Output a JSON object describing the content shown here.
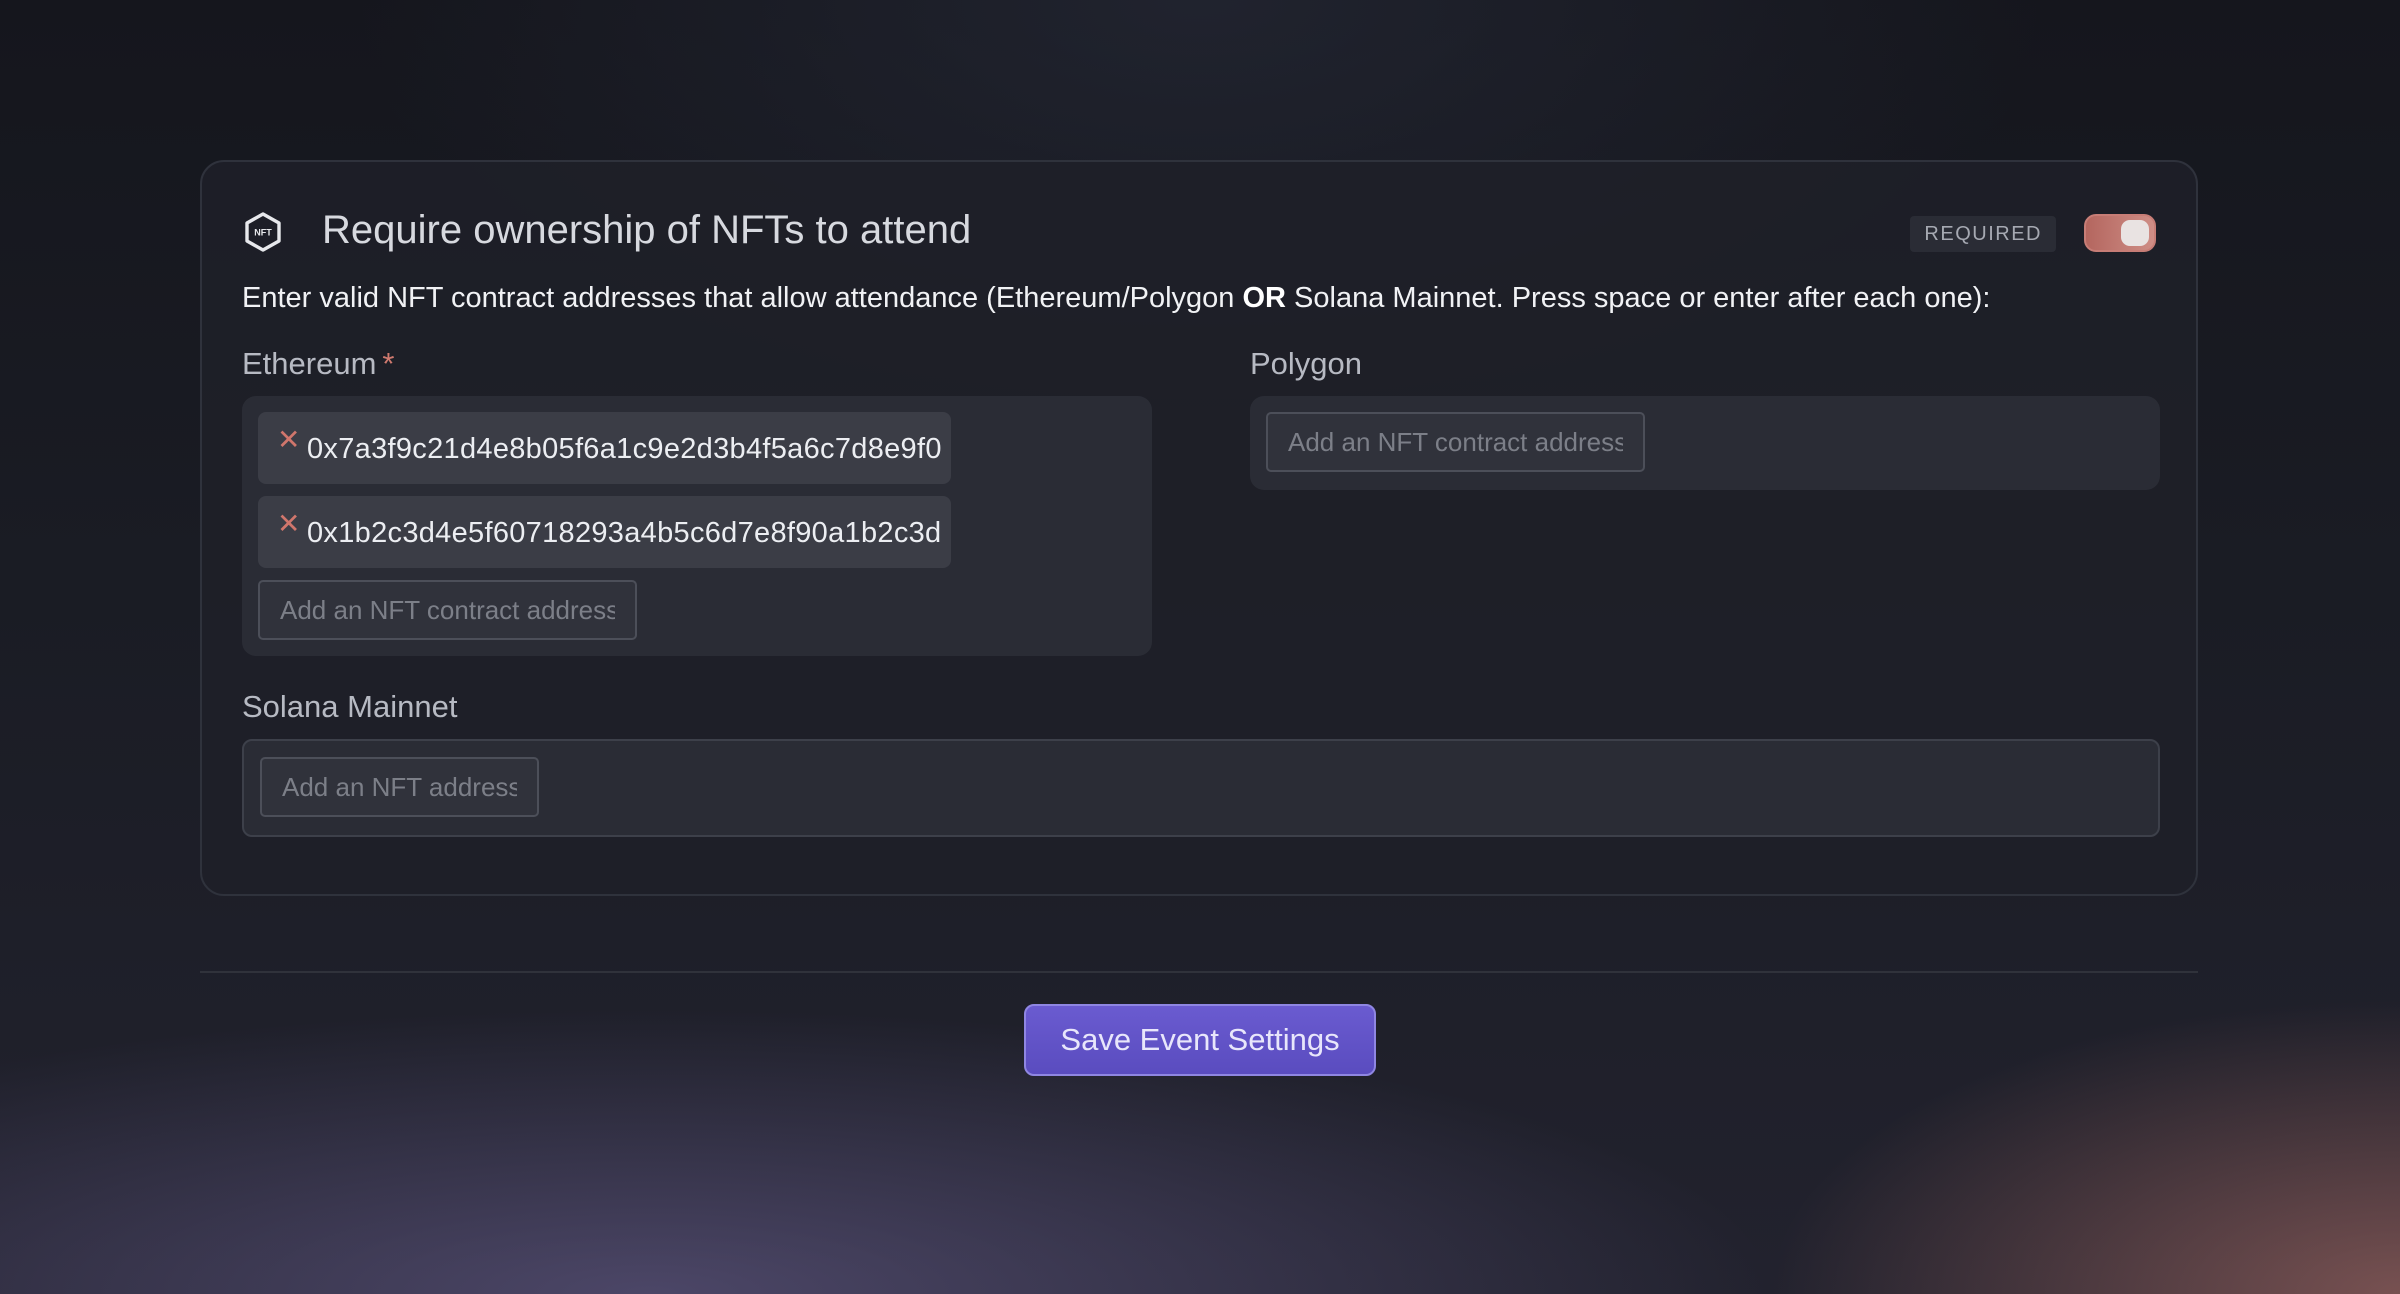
{
  "header": {
    "title": "Require ownership of NFTs to attend",
    "icon": "nft-hexagon-icon",
    "icon_text": "NFT",
    "badge": "REQUIRED",
    "toggle_on": true
  },
  "instructions": {
    "before": "Enter valid NFT contract addresses that allow attendance (Ethereum/Polygon ",
    "bold": "OR",
    "after": " Solana Mainnet. Press space or enter after each one):"
  },
  "ethereum": {
    "label": "Ethereum",
    "required_marker": "*",
    "addresses": [
      "0x7a3f9c21d4e8b05f6a1c9e2d3b4f5a6c7d8e9f0",
      "0x1b2c3d4e5f60718293a4b5c6d7e8f90a1b2c3d"
    ],
    "remove_glyph": "✕",
    "placeholder": "Add an NFT contract address"
  },
  "polygon": {
    "label": "Polygon",
    "placeholder": "Add an NFT contract address"
  },
  "solana": {
    "label": "Solana Mainnet",
    "placeholder": "Add an NFT address"
  },
  "actions": {
    "save_label": "Save Event Settings"
  },
  "colors": {
    "accent": "#5f51c6",
    "toggle": "#c27a72",
    "remove": "#d0766c"
  }
}
